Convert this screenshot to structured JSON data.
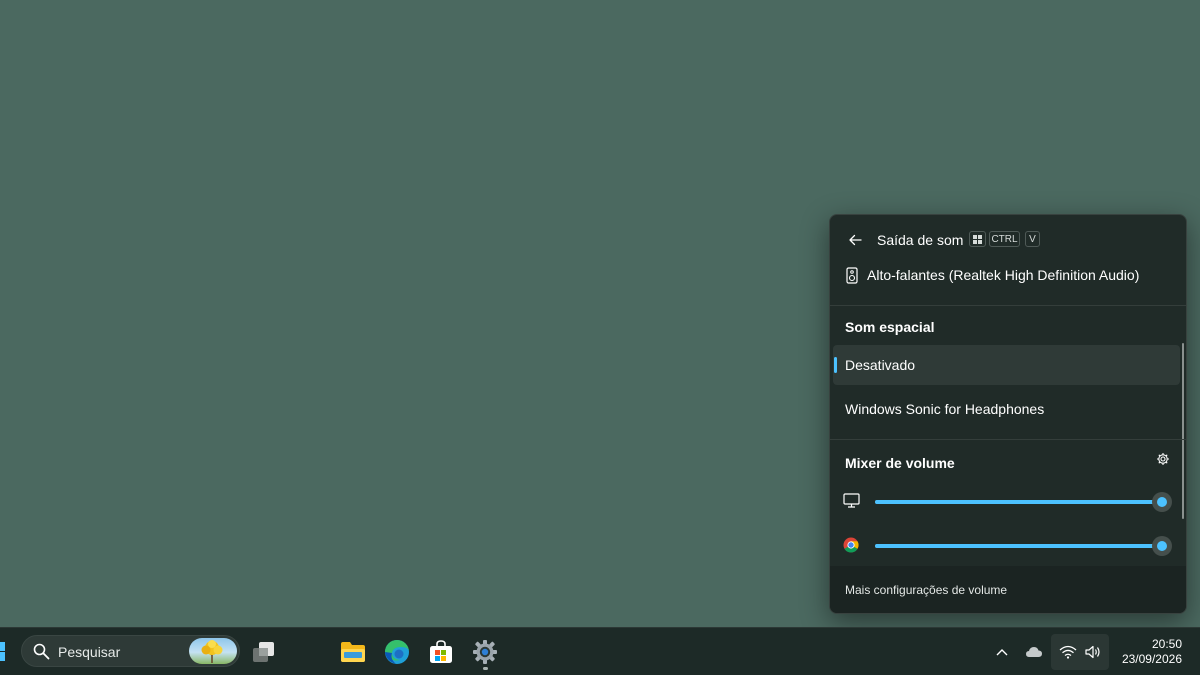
{
  "flyout": {
    "title": "Saída de som",
    "shortcut_keys": [
      "CTRL",
      "V"
    ],
    "device_name": "Alto-falantes (Realtek High Definition Audio)",
    "spatial_title": "Som espacial",
    "spatial_options": [
      {
        "label": "Desativado",
        "selected": true
      },
      {
        "label": "Windows Sonic for Headphones",
        "selected": false
      }
    ],
    "mixer_title": "Mixer de volume",
    "mixer": [
      {
        "icon": "monitor-icon",
        "volume": 100
      },
      {
        "icon": "chrome-icon",
        "volume": 100
      }
    ],
    "footer_link": "Mais configurações de volume"
  },
  "taskbar": {
    "search_placeholder": "Pesquisar",
    "apps": [
      "task-view-icon",
      "file-explorer-icon",
      "edge-icon",
      "microsoft-store-icon",
      "settings-icon"
    ],
    "tray_icons": [
      "chevron-up-icon",
      "onedrive-cloud-icon",
      "wifi-icon",
      "speaker-icon"
    ],
    "time": "20:50",
    "date": "23/09/2026"
  },
  "colors": {
    "desktop": "#4b6960",
    "accent": "#4cc2ff",
    "flyout_bg": "#202b28",
    "taskbar_bg": "#1d2a27"
  }
}
